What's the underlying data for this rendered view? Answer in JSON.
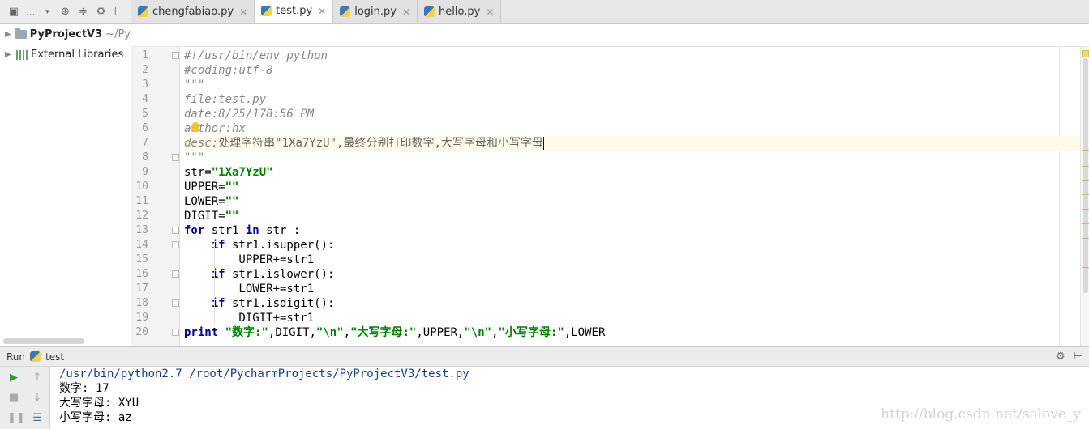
{
  "project_panel": {
    "title_truncated": "...",
    "project_name": "PyProjectV3",
    "project_path": "~/Py",
    "libraries_label": "External Libraries"
  },
  "tabs": [
    {
      "label": "chengfabiao.py",
      "active": false
    },
    {
      "label": "test.py",
      "active": true
    },
    {
      "label": "login.py",
      "active": false
    },
    {
      "label": "hello.py",
      "active": false
    }
  ],
  "editor": {
    "lines": [
      "#!/usr/bin/env python",
      "#coding:utf-8",
      "\"\"\"",
      "file:test.py",
      "date:8/25/178:56 PM",
      "author:hx",
      "desc:处理字符串\"1Xa7YzU\",最终分别打印数字,大写字母和小写字母",
      "\"\"\"",
      "str=\"1Xa7YzU\"",
      "UPPER=\"\"",
      "LOWER=\"\"",
      "DIGIT=\"\"",
      "for str1 in str :",
      "    if str1.isupper():",
      "        UPPER+=str1",
      "    if str1.islower():",
      "        LOWER+=str1",
      "    if str1.isdigit():",
      "        DIGIT+=str1",
      "print \"数字:\",DIGIT,\"\\n\",\"大写字母:\",UPPER,\"\\n\",\"小写字母:\",LOWER"
    ],
    "current_line": 7
  },
  "run_panel": {
    "label": "Run",
    "config_name": "test",
    "console": [
      "/usr/bin/python2.7 /root/PycharmProjects/PyProjectV3/test.py",
      "数字: 17",
      "大写字母: XYU",
      "小写字母: az"
    ]
  },
  "watermark": "http://blog.csdn.net/salove_y",
  "colors": {
    "keyword": "#000080",
    "string": "#008000",
    "comment": "#888888",
    "current_line_bg": "#fcfae9",
    "run_green": "#2e9e2e"
  }
}
